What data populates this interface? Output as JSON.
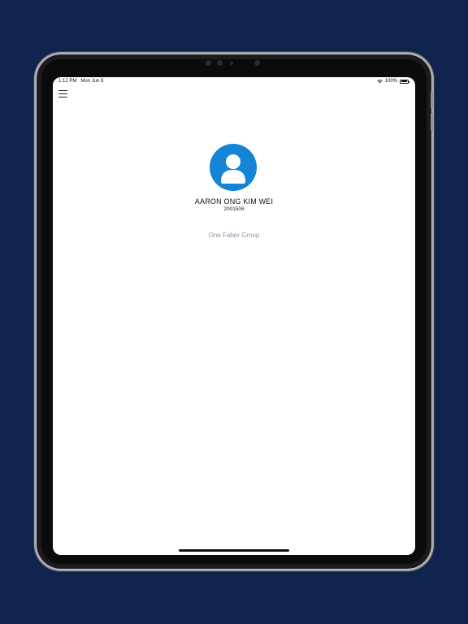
{
  "status_bar": {
    "time": "1:12 PM",
    "date": "Mon Jun 8",
    "battery": "100%",
    "wifi_icon": "wifi-icon",
    "battery_icon": "battery-icon"
  },
  "nav": {
    "menu_icon": "hamburger-menu-icon"
  },
  "profile": {
    "avatar_icon": "person-icon",
    "avatar_color": "#1583d6",
    "name": "AARON ONG KIM WEI",
    "employee_id": "2001506",
    "organization": "One Faber Group"
  },
  "colors": {
    "background": "#0f234c",
    "screen": "#ffffff",
    "org_link": "#8a96aa"
  }
}
